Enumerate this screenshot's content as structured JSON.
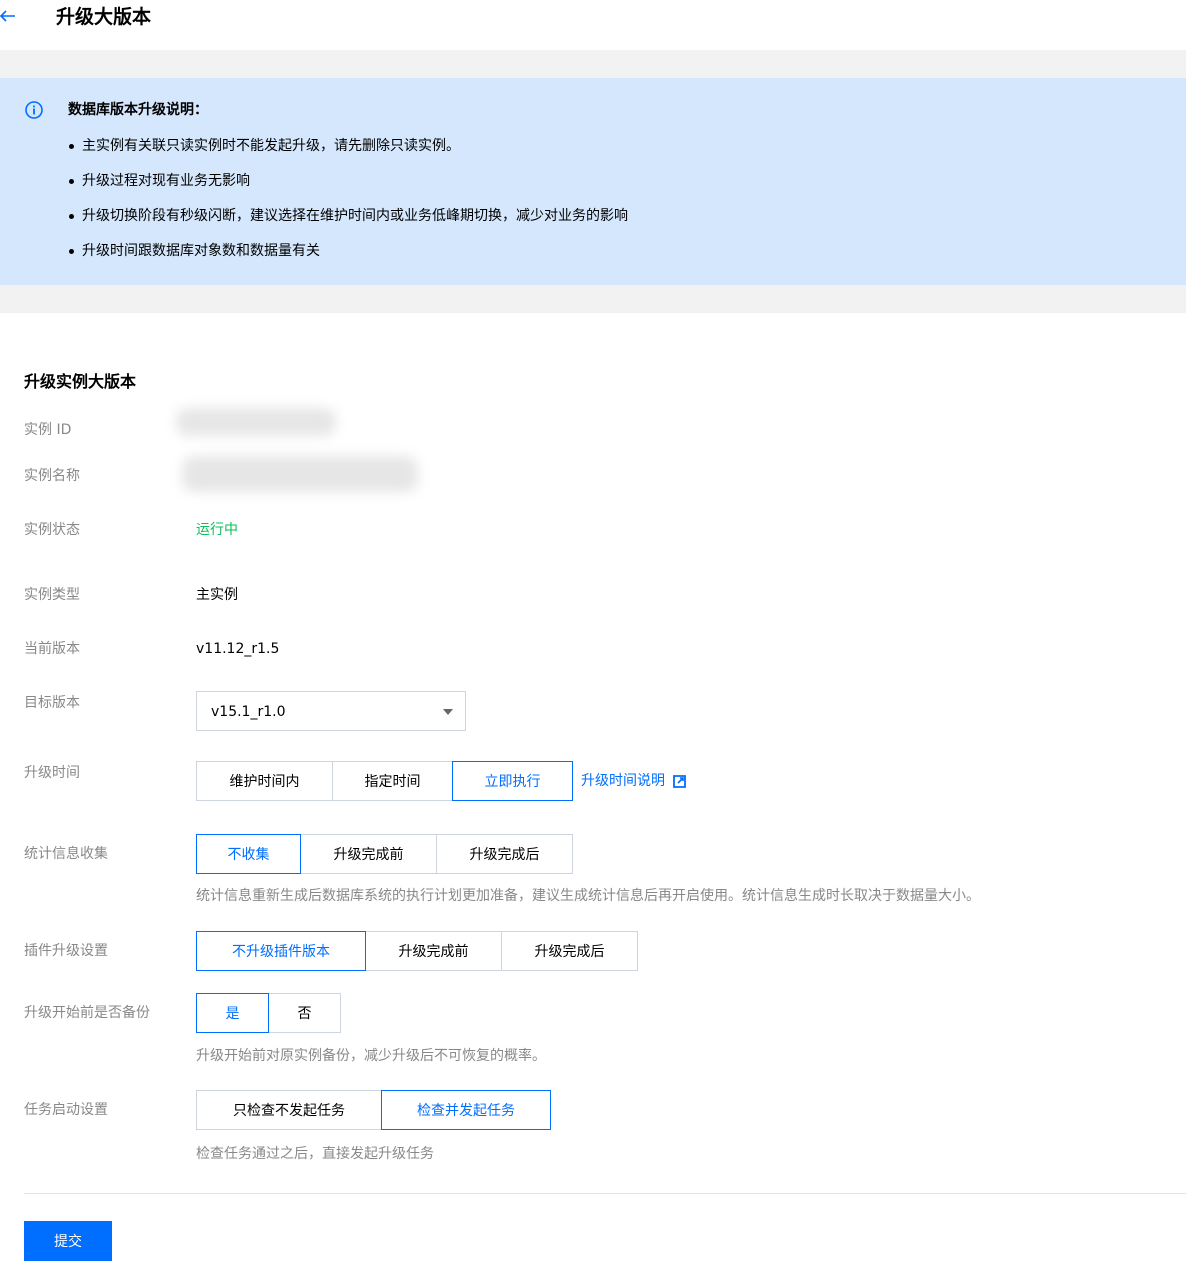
{
  "header": {
    "title": "升级大版本",
    "back_icon": "arrow-left-icon"
  },
  "notice": {
    "icon": "info-circle-icon",
    "title": "数据库版本升级说明：",
    "items": [
      "主实例有关联只读实例时不能发起升级，请先删除只读实例。",
      "升级过程对现有业务无影响",
      "升级切换阶段有秒级闪断，建议选择在维护时间内或业务低峰期切换，减少对业务的影响",
      "升级时间跟数据库对象数和数据量有关"
    ]
  },
  "form": {
    "section_title": "升级实例大版本",
    "instance_id": {
      "label": "实例 ID"
    },
    "instance_name": {
      "label": "实例名称"
    },
    "instance_status": {
      "label": "实例状态",
      "value": "运行中",
      "color": "#0abf5b"
    },
    "instance_type": {
      "label": "实例类型",
      "value": "主实例"
    },
    "current_version": {
      "label": "当前版本",
      "value": "v11.12_r1.5"
    },
    "target_version": {
      "label": "目标版本",
      "value": "v15.1_r1.0"
    },
    "upgrade_time": {
      "label": "升级时间",
      "options": [
        "维护时间内",
        "指定时间",
        "立即执行"
      ],
      "selected": "立即执行",
      "link": "升级时间说明"
    },
    "stats_collection": {
      "label": "统计信息收集",
      "options": [
        "不收集",
        "升级完成前",
        "升级完成后"
      ],
      "selected": "不收集",
      "hint": "统计信息重新生成后数据库系统的执行计划更加准备，建议生成统计信息后再开启使用。统计信息生成时长取决于数据量大小。"
    },
    "plugin_upgrade": {
      "label": "插件升级设置",
      "options": [
        "不升级插件版本",
        "升级完成前",
        "升级完成后"
      ],
      "selected": "不升级插件版本"
    },
    "backup_before": {
      "label": "升级开始前是否备份",
      "options": [
        "是",
        "否"
      ],
      "selected": "是",
      "hint": "升级开始前对原实例备份，减少升级后不可恢复的概率。"
    },
    "task_start": {
      "label": "任务启动设置",
      "options": [
        "只检查不发起任务",
        "检查并发起任务"
      ],
      "selected": "检查并发起任务",
      "hint": "检查任务通过之后，直接发起升级任务"
    }
  },
  "submit_label": "提交",
  "colors": {
    "primary": "#006eff",
    "notice_bg": "#d5e7fd",
    "success": "#0abf5b"
  }
}
